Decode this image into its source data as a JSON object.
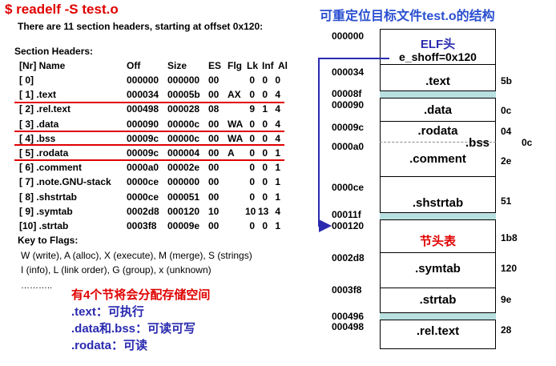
{
  "left": {
    "command": "$ readelf -S test.o",
    "intro": "There are 11 section headers, starting at offset 0x120:",
    "section_headers_title": "Section Headers:",
    "columns": [
      "[Nr] Name",
      "Off",
      "Size",
      "ES",
      "Flg",
      "Lk",
      "Inf",
      "Al"
    ],
    "rows": [
      {
        "nr": "[ 0]",
        "off": "000000",
        "size": "000000",
        "es": "00",
        "flg": "",
        "lk": "0",
        "inf": "0",
        "al": "0"
      },
      {
        "nr": "[ 1] .text",
        "off": "000034",
        "size": "00005b",
        "es": "00",
        "flg": "AX",
        "lk": "0",
        "inf": "0",
        "al": "4"
      },
      {
        "nr": "[ 2] .rel.text",
        "off": "000498",
        "size": "000028",
        "es": "08",
        "flg": "",
        "lk": "9",
        "inf": "1",
        "al": "4"
      },
      {
        "nr": "[ 3] .data",
        "off": "000090",
        "size": "00000c",
        "es": "00",
        "flg": "WA",
        "lk": "0",
        "inf": "0",
        "al": "4"
      },
      {
        "nr": "[ 4] .bss",
        "off": "00009c",
        "size": "00000c",
        "es": "00",
        "flg": "WA",
        "lk": "0",
        "inf": "0",
        "al": "4"
      },
      {
        "nr": "[ 5] .rodata",
        "off": "00009c",
        "size": "000004",
        "es": "00",
        "flg": "A",
        "lk": "0",
        "inf": "0",
        "al": "1"
      },
      {
        "nr": "[ 6] .comment",
        "off": "0000a0",
        "size": "00002e",
        "es": "00",
        "flg": "",
        "lk": "0",
        "inf": "0",
        "al": "1"
      },
      {
        "nr": "[ 7] .note.GNU-stack",
        "off": "0000ce",
        "size": "000000",
        "es": "00",
        "flg": "",
        "lk": "0",
        "inf": "0",
        "al": "1"
      },
      {
        "nr": "[ 8] .shstrtab",
        "off": "0000ce",
        "size": "000051",
        "es": "00",
        "flg": "",
        "lk": "0",
        "inf": "0",
        "al": "1"
      },
      {
        "nr": "[ 9] .symtab",
        "off": "0002d8",
        "size": "000120",
        "es": "10",
        "flg": "",
        "lk": "10",
        "inf": "13",
        "al": "4"
      },
      {
        "nr": "[10] .strtab",
        "off": "0003f8",
        "size": "00009e",
        "es": "00",
        "flg": "",
        "lk": "0",
        "inf": "0",
        "al": "1"
      }
    ],
    "key_title": "Key to Flags:",
    "key_lines": [
      "W (write), A (alloc), X (execute), M (merge), S (strings)",
      "I (info), L (link order), G (group), x (unknown)"
    ],
    "ellipsis": "………..",
    "annotation_title": "有4个节将会分配存储空间",
    "annotation_lines": [
      ".text：可执行",
      ".data和.bss：可读可写",
      ".rodata：可读"
    ]
  },
  "right": {
    "title": "可重定位目标文件test.o的结构",
    "elf_header": "ELF头",
    "e_shoff": "e_shoff=0x120",
    "sections": {
      "text": ".text",
      "data": ".data",
      "rodata": ".rodata",
      "bss": ".bss",
      "comment": ".comment",
      "shstrtab": ".shstrtab",
      "sht": "节头表",
      "symtab": ".symtab",
      "strtab": ".strtab",
      "reltext": ".rel.text"
    },
    "addresses": [
      "000000",
      "000034",
      "00008f",
      "000090",
      "00009c",
      "0000a0",
      "0000ce",
      "00011f",
      "000120",
      "0002d8",
      "0003f8",
      "000496",
      "000498"
    ],
    "sizes": [
      "5b",
      "0c",
      "04",
      "0c",
      "2e",
      "51",
      "1b8",
      "120",
      "9e",
      "28"
    ]
  },
  "colors": {
    "red": "#e00000",
    "blue": "#2a2ab0",
    "title_blue": "#2a4fd0",
    "band": "#b9e0e0"
  }
}
